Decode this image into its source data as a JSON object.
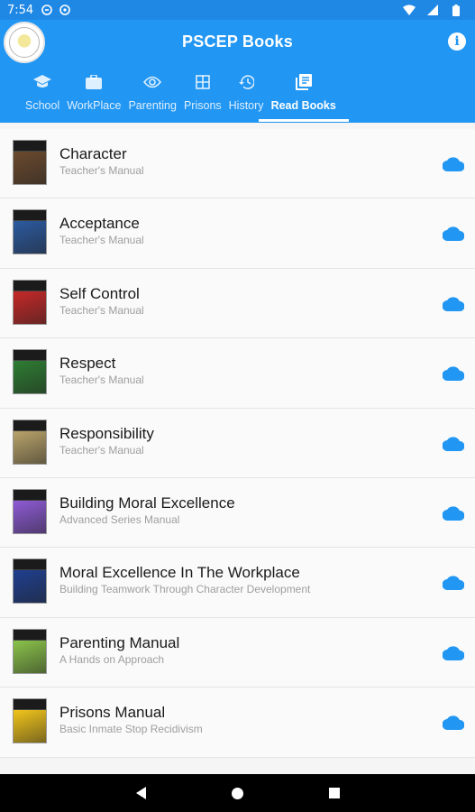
{
  "status_bar": {
    "time": "7:54"
  },
  "app": {
    "title": "PSCEP Books",
    "info_icon": "info-icon",
    "accent": "#2196f3"
  },
  "tabs": [
    {
      "label": "School",
      "icon": "school-icon",
      "active": false
    },
    {
      "label": "WorkPlace",
      "icon": "briefcase-icon",
      "active": false
    },
    {
      "label": "Parenting",
      "icon": "eye-icon",
      "active": false
    },
    {
      "label": "Prisons",
      "icon": "grid-icon",
      "active": false
    },
    {
      "label": "History",
      "icon": "history-icon",
      "active": false
    },
    {
      "label": "Read Books",
      "icon": "library-books-icon",
      "active": true
    }
  ],
  "books": [
    {
      "title": "Character",
      "subtitle": "Teacher's Manual",
      "cover_color": "#6b4a2e"
    },
    {
      "title": "Acceptance",
      "subtitle": "Teacher's Manual",
      "cover_color": "#2c5aa0"
    },
    {
      "title": "Self Control",
      "subtitle": "Teacher's Manual",
      "cover_color": "#c62828"
    },
    {
      "title": "Respect",
      "subtitle": "Teacher's Manual",
      "cover_color": "#2e7d32"
    },
    {
      "title": "Responsibility",
      "subtitle": "Teacher's Manual",
      "cover_color": "#b8a36a"
    },
    {
      "title": "Building Moral Excellence",
      "subtitle": "Advanced Series Manual",
      "cover_color": "#8e5bd6"
    },
    {
      "title": "Moral Excellence In The Workplace",
      "subtitle": "Building Teamwork Through Character Development",
      "cover_color": "#1f3f8f"
    },
    {
      "title": "Parenting Manual",
      "subtitle": "A Hands on Approach",
      "cover_color": "#8bc34a"
    },
    {
      "title": "Prisons Manual",
      "subtitle": "Basic Inmate Stop Recidivism",
      "cover_color": "#f2c51b"
    }
  ],
  "cloud_icon_color": "#2196f3"
}
